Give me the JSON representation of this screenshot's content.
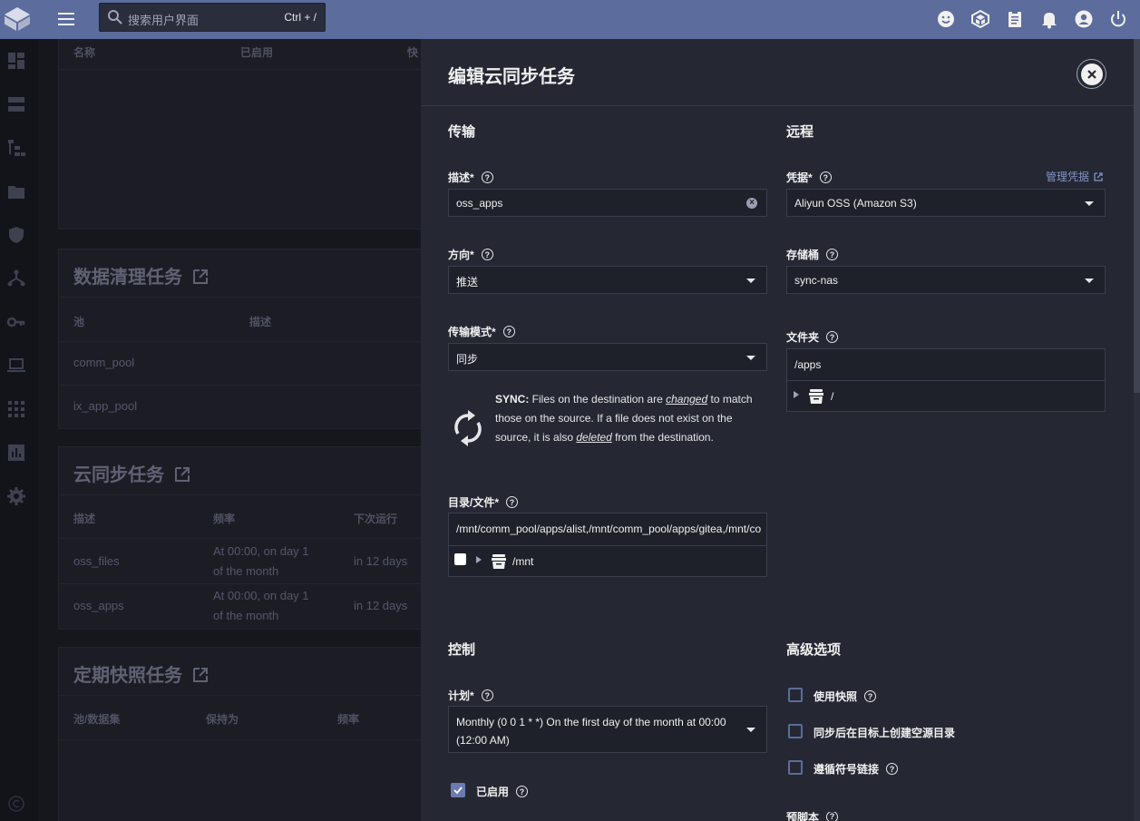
{
  "topbar": {
    "search_placeholder": "搜索用户界面",
    "search_shortcut": "Ctrl + /"
  },
  "background": {
    "table1": {
      "headers": [
        "名称",
        "已启用",
        "快"
      ]
    },
    "scrub": {
      "title": "数据清理任务",
      "headers": [
        "池",
        "描述"
      ],
      "rows": [
        "comm_pool",
        "ix_app_pool"
      ]
    },
    "cloudsync": {
      "title": "云同步任务",
      "headers": [
        "描述",
        "频率",
        "下次运行"
      ],
      "rows": [
        {
          "desc": "oss_files",
          "freq1": "At 00:00, on day 1",
          "freq2": "of the month",
          "next": "in 12 days"
        },
        {
          "desc": "oss_apps",
          "freq1": "At 00:00, on day 1",
          "freq2": "of the month",
          "next": "in 12 days"
        }
      ]
    },
    "snapshot": {
      "title": "定期快照任务",
      "headers": [
        "池/数据集",
        "保持为",
        "频率"
      ]
    }
  },
  "dialog": {
    "title": "编辑云同步任务",
    "transfer": {
      "section": "传输",
      "desc_label": "描述",
      "desc_value": "oss_apps",
      "direction_label": "方向",
      "direction_value": "推送",
      "mode_label": "传输模式",
      "mode_value": "同步",
      "sync_title": "SYNC:",
      "sync_t1": " Files on the destination are ",
      "sync_changed": "changed",
      "sync_t2": " to match those on the source. If a file does not exist on the source, it is also ",
      "sync_deleted": "deleted",
      "sync_t3": " from the destination.",
      "dir_label": "目录/文件",
      "dir_value": "/mnt/comm_pool/apps/alist,/mnt/comm_pool/apps/gitea,/mnt/co",
      "dir_tree_root": "/mnt"
    },
    "remote": {
      "section": "远程",
      "cred_label": "凭据",
      "manage_link": "管理凭据",
      "cred_value": "Aliyun OSS (Amazon S3)",
      "bucket_label": "存储桶",
      "bucket_value": "sync-nas",
      "folder_label": "文件夹",
      "folder_value": "/apps",
      "folder_tree_root": "/"
    },
    "control": {
      "section": "控制",
      "schedule_label": "计划",
      "schedule_value_1": "Monthly (0 0 1 * *)  On the first day of the month at 00:00",
      "schedule_value_2": "(12:00 AM)",
      "enabled_label": "已启用"
    },
    "advanced": {
      "section": "高级选项",
      "opt_snapshot": "使用快照",
      "opt_empty_dirs": "同步后在目标上创建空源目录",
      "opt_symlinks": "遵循符号链接",
      "pre_script": "预脚本"
    },
    "required_mark": "*",
    "help_glyph": "?"
  }
}
